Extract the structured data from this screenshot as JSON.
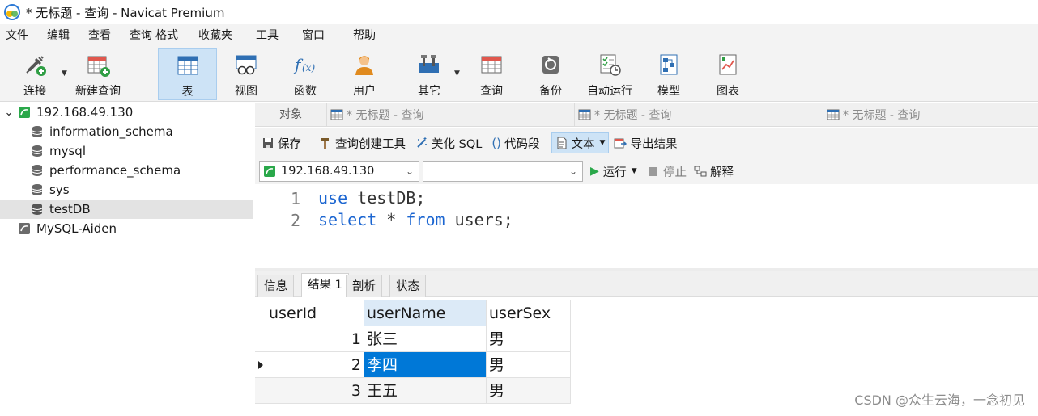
{
  "window": {
    "title": "* 无标题 - 查询 - Navicat Premium"
  },
  "menu": [
    "文件",
    "编辑",
    "查看",
    "查询",
    "格式",
    "收藏夹",
    "工具",
    "窗口",
    "帮助"
  ],
  "toolbar": {
    "connect": "连接",
    "new_query": "新建查询",
    "table": "表",
    "view": "视图",
    "function": "函数",
    "user": "用户",
    "other": "其它",
    "query": "查询",
    "backup": "备份",
    "auto_run": "自动运行",
    "model": "模型",
    "chart": "图表"
  },
  "sidebar": {
    "connections": [
      {
        "label": "192.168.49.130",
        "expanded": true,
        "databases": [
          "information_schema",
          "mysql",
          "performance_schema",
          "sys",
          "testDB"
        ],
        "selected_db": "testDB"
      },
      {
        "label": "MySQL-Aiden",
        "expanded": false
      }
    ]
  },
  "tabs": {
    "objects": "对象",
    "query_tabs": [
      "* 无标题 - 查询",
      "* 无标题 - 查询",
      "* 无标题 - 查询"
    ]
  },
  "query_toolbar": {
    "save": "保存",
    "builder": "查询创建工具",
    "beautify": "美化 SQL",
    "snippet": "代码段",
    "text": "文本",
    "export": "导出结果"
  },
  "connection_bar": {
    "connection": "192.168.49.130",
    "database": "",
    "run": "运行",
    "stop": "停止",
    "explain": "解释"
  },
  "editor": {
    "line_numbers": [
      "1",
      "2"
    ],
    "line1": {
      "kw": "use",
      "rest": " testDB;"
    },
    "line2": {
      "kw1": "select",
      "mid": " * ",
      "kw2": "from",
      "rest": " users;"
    }
  },
  "result_tabs": [
    "信息",
    "结果 1",
    "剖析",
    "状态"
  ],
  "result": {
    "columns": [
      "userId",
      "userName",
      "userSex"
    ],
    "rows": [
      [
        "1",
        "张三",
        "男"
      ],
      [
        "2",
        "李四",
        "男"
      ],
      [
        "3",
        "王五",
        "男"
      ]
    ]
  },
  "watermark": "CSDN @众生云海，一念初见",
  "colors": {
    "selection": "#0078d7",
    "keyword": "#1c66d1",
    "active_tool": "#cde3f6"
  }
}
